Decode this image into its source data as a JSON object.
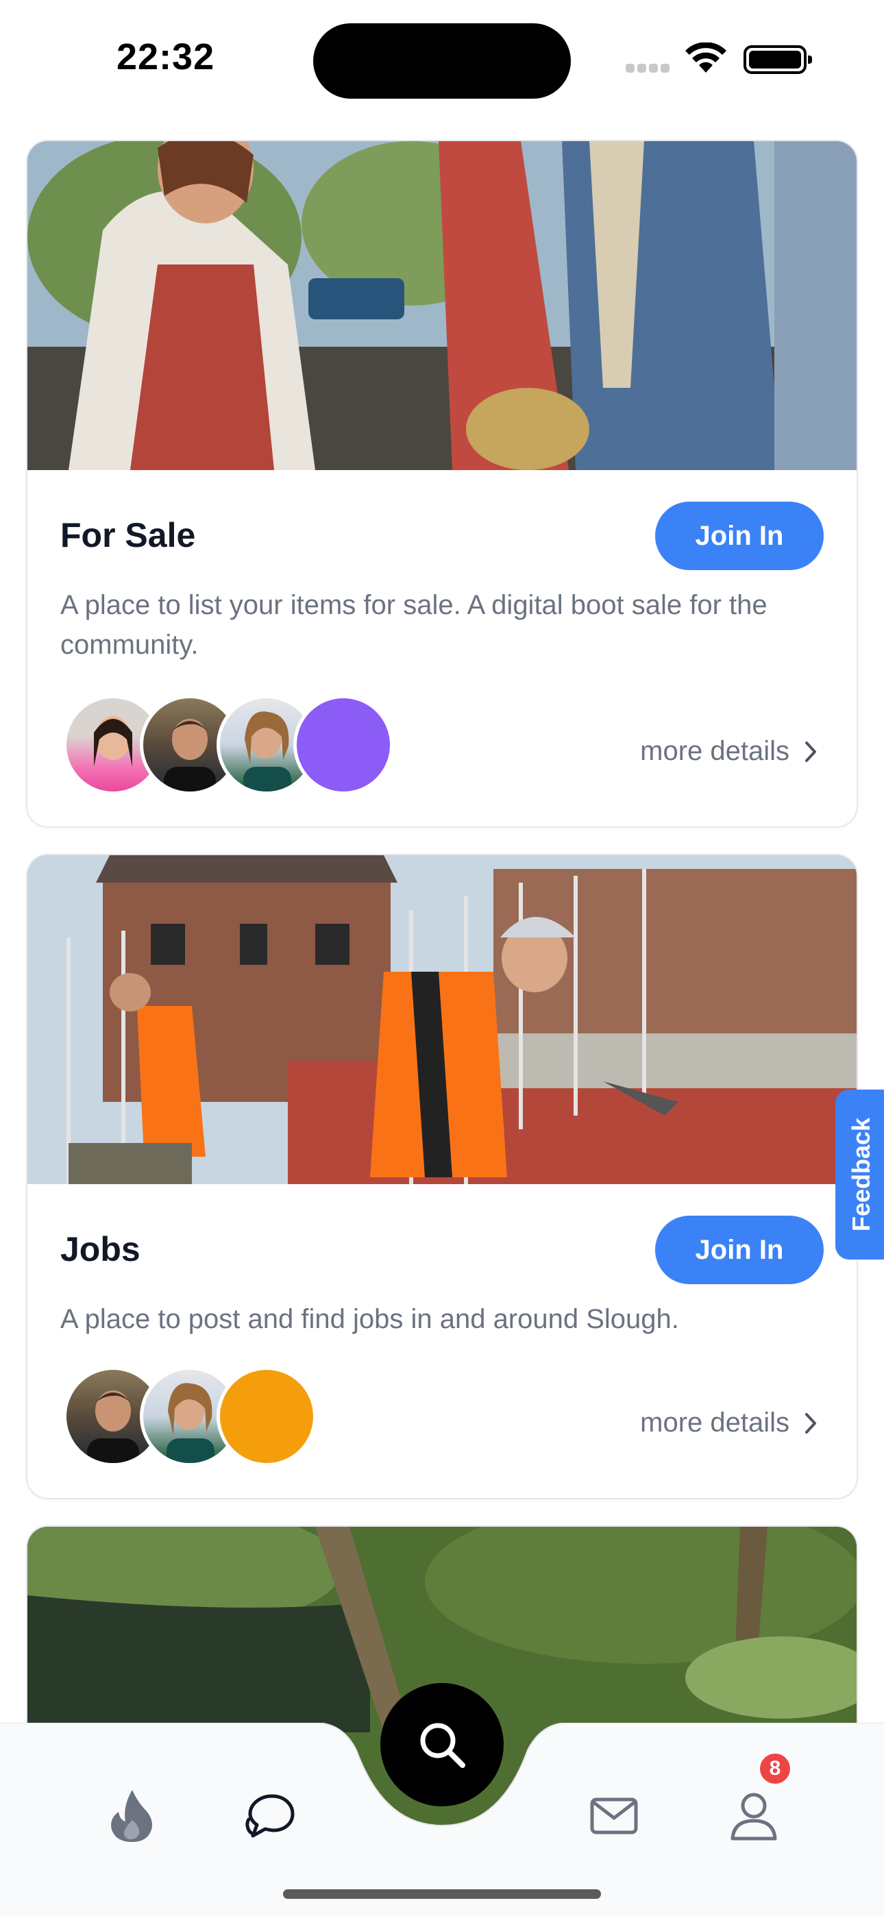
{
  "status_bar": {
    "time": "22:32"
  },
  "cards": [
    {
      "title": "For Sale",
      "join_label": "Join In",
      "description": "A place to list your items for sale. A digital boot sale for the community.",
      "more_details": "more details",
      "avatar_colors": [
        "#f472b6",
        "#4b5563",
        "#14532d",
        "#8b5cf6"
      ]
    },
    {
      "title": "Jobs",
      "join_label": "Join In",
      "description": "A place to post and find jobs in and around Slough.",
      "more_details": "more details",
      "avatar_colors": [
        "#4b5563",
        "#14532d",
        "#f59e0b"
      ]
    }
  ],
  "feedback": {
    "label": "Feedback"
  },
  "nav": {
    "items": [
      "flame-icon",
      "chat-icon",
      "search-icon",
      "mail-icon",
      "user-icon"
    ],
    "badge_count": "8"
  },
  "colors": {
    "accent": "#3b82f6",
    "badge": "#ef4444"
  }
}
